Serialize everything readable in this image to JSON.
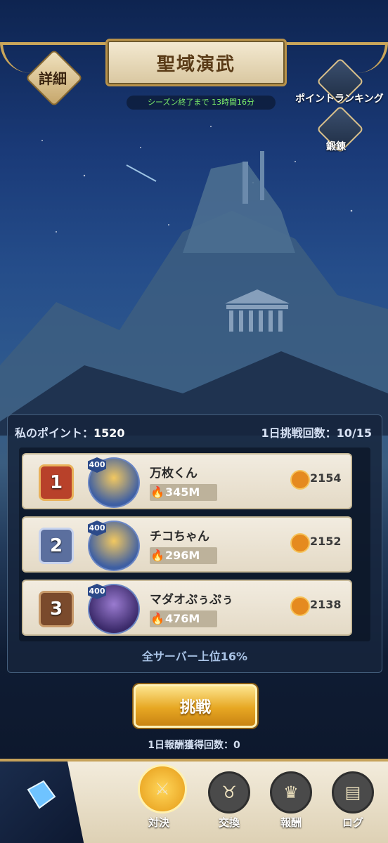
{
  "header": {
    "title": "聖域演武",
    "detail_label": "詳細",
    "season_timer": "シーズン終了まで 13時間16分",
    "ranking_label": "ポイントランキング",
    "training_label": "鍛錬"
  },
  "panel": {
    "my_points_label": "私のポイント：",
    "my_points_value": "1520",
    "daily_label": "1日挑戦回数：",
    "daily_value": "10/15",
    "top_percent": "全サーバー上位16%"
  },
  "ranking": [
    {
      "rank": "1",
      "level": "400",
      "name": "万枚くん",
      "power": "345M",
      "score": "2154"
    },
    {
      "rank": "2",
      "level": "400",
      "name": "チコちゃん",
      "power": "296M",
      "score": "2152"
    },
    {
      "rank": "3",
      "level": "400",
      "name": "マダオぷぅぷぅ",
      "power": "476M",
      "score": "2138"
    }
  ],
  "challenge_label": "挑戦",
  "reward_count": "1日報酬獲得回数：0",
  "nav": [
    {
      "label": "対決",
      "icon": "versus-icon"
    },
    {
      "label": "交換",
      "icon": "exchange-icon"
    },
    {
      "label": "報酬",
      "icon": "reward-icon"
    },
    {
      "label": "ログ",
      "icon": "log-icon"
    }
  ],
  "colors": {
    "gold": "#c9a55a",
    "timer_green": "#7cf06b",
    "button_gold": "#e7a723"
  }
}
